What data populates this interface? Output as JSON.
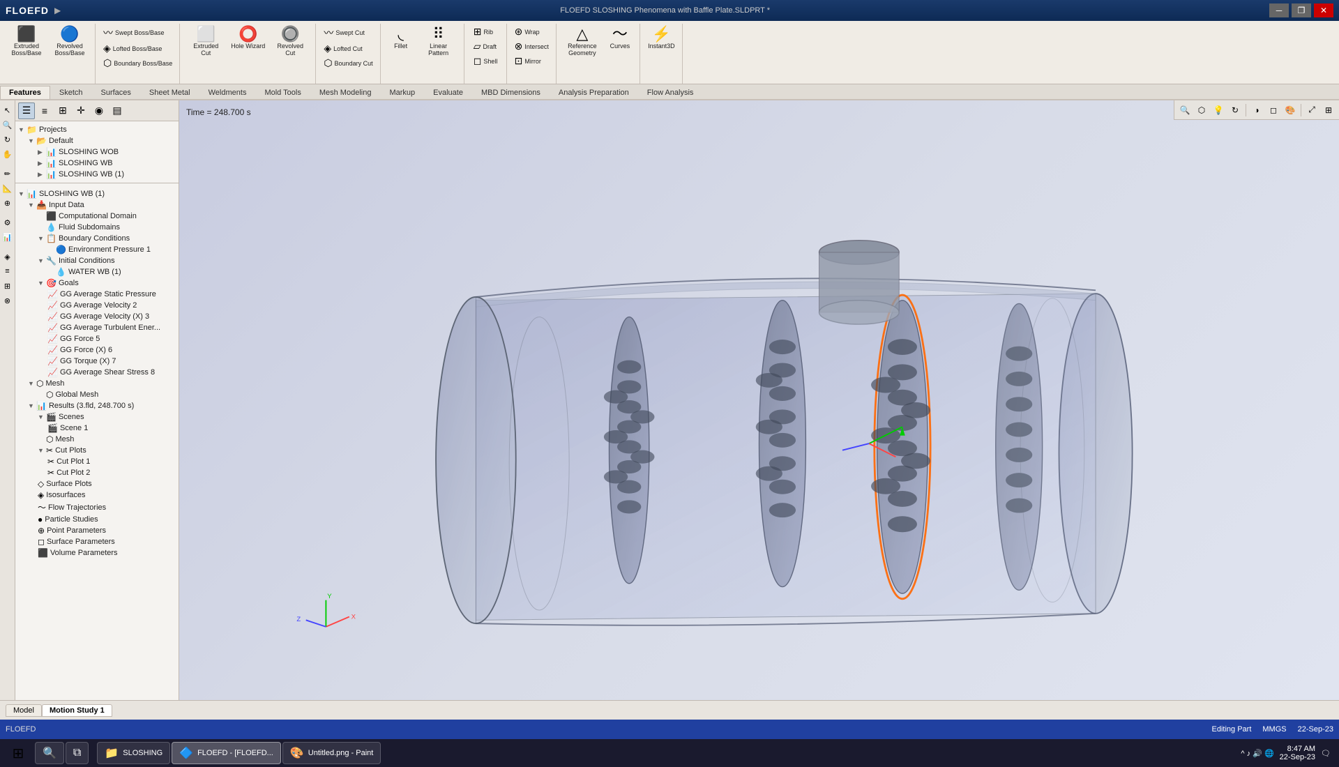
{
  "titlebar": {
    "logo": "FLOEFD",
    "title": "FLOEFD SLOSHING Phenomena with Baffle Plate.SLDPRT *",
    "win_min": "─",
    "win_restore": "❐",
    "win_close": "✕"
  },
  "ribbon": {
    "groups": [
      {
        "name": "extrude-group",
        "buttons": [
          {
            "id": "extruded-boss",
            "icon": "⬛",
            "label": "Extruded Boss/Base"
          },
          {
            "id": "revolved-boss",
            "icon": "🔵",
            "label": "Revolved Boss/Base"
          }
        ]
      },
      {
        "name": "swept-group",
        "buttons": [
          {
            "id": "swept-boss",
            "icon": "〰",
            "label": "Swept Boss/Base"
          },
          {
            "id": "lofted-boss",
            "icon": "◈",
            "label": "Lofted Boss/Base"
          },
          {
            "id": "boundary-boss",
            "icon": "⬡",
            "label": "Boundary Boss/Base"
          }
        ]
      },
      {
        "name": "cut-group",
        "buttons": [
          {
            "id": "extruded-cut",
            "icon": "⬜",
            "label": "Extruded Cut"
          },
          {
            "id": "hole-wizard",
            "icon": "⭕",
            "label": "Hole Wizard"
          },
          {
            "id": "revolved-cut",
            "icon": "🔘",
            "label": "Revolved Cut"
          }
        ]
      },
      {
        "name": "cut-group2",
        "buttons": [
          {
            "id": "swept-cut",
            "icon": "〰",
            "label": "Swept Cut"
          },
          {
            "id": "lofted-cut",
            "icon": "◈",
            "label": "Lofted Cut"
          },
          {
            "id": "boundary-cut",
            "icon": "⬡",
            "label": "Boundary Cut"
          }
        ]
      },
      {
        "name": "features-group",
        "buttons": [
          {
            "id": "fillet",
            "icon": "◟",
            "label": "Fillet"
          },
          {
            "id": "linear-pattern",
            "icon": "⠿",
            "label": "Linear Pattern"
          }
        ]
      },
      {
        "name": "features-group2",
        "buttons": [
          {
            "id": "rib",
            "icon": "⊞",
            "label": "Rib"
          },
          {
            "id": "draft",
            "icon": "▱",
            "label": "Draft"
          },
          {
            "id": "shell",
            "icon": "◻",
            "label": "Shell"
          }
        ]
      },
      {
        "name": "wrap-group",
        "buttons": [
          {
            "id": "wrap",
            "icon": "⊛",
            "label": "Wrap"
          },
          {
            "id": "intersect",
            "icon": "⊗",
            "label": "Intersect"
          },
          {
            "id": "mirror",
            "icon": "⊡",
            "label": "Mirror"
          }
        ]
      },
      {
        "name": "ref-group",
        "buttons": [
          {
            "id": "reference-geometry",
            "icon": "△",
            "label": "Reference Geometry"
          },
          {
            "id": "curves",
            "icon": "〜",
            "label": "Curves"
          }
        ]
      },
      {
        "name": "instant3d-group",
        "buttons": [
          {
            "id": "instant3d",
            "icon": "⚡",
            "label": "Instant3D"
          }
        ]
      }
    ]
  },
  "feature_tabs": [
    "Features",
    "Sketch",
    "Surfaces",
    "Sheet Metal",
    "Weldments",
    "Mold Tools",
    "Mesh Modeling",
    "Markup",
    "Evaluate",
    "MBD Dimensions",
    "Analysis Preparation",
    "Flow Analysis"
  ],
  "active_feature_tab": "Features",
  "panel_toolbar": {
    "buttons": [
      "☰",
      "≡",
      "⊞",
      "✛",
      "◉",
      "▤"
    ]
  },
  "tree": {
    "sections": [
      {
        "id": "projects",
        "label": "Projects",
        "icon": "📁",
        "expanded": true,
        "children": [
          {
            "id": "default",
            "label": "Default",
            "icon": "📂",
            "expanded": true,
            "children": [
              {
                "id": "sloshing-wob",
                "label": "SLOSHING WOB",
                "icon": "📊",
                "indent": 2
              },
              {
                "id": "sloshing-wb",
                "label": "SLOSHING WB",
                "icon": "📊",
                "indent": 2
              },
              {
                "id": "sloshing-wb1",
                "label": "SLOSHING WB (1)",
                "icon": "📊",
                "indent": 2
              }
            ]
          }
        ]
      },
      {
        "id": "sloshing-wb-main",
        "label": "SLOSHING WB (1)",
        "icon": "📊",
        "expanded": true,
        "separator": true,
        "children": [
          {
            "id": "input-data",
            "label": "Input Data",
            "icon": "📥",
            "indent": 1,
            "expanded": true,
            "children": [
              {
                "id": "comp-domain",
                "label": "Computational Domain",
                "icon": "⬛",
                "indent": 2
              },
              {
                "id": "fluid-sub",
                "label": "Fluid Subdomains",
                "icon": "💧",
                "indent": 2
              },
              {
                "id": "boundary-cond",
                "label": "Boundary Conditions",
                "icon": "📋",
                "indent": 2,
                "expanded": true,
                "children": [
                  {
                    "id": "env-pressure",
                    "label": "Environment Pressure 1",
                    "icon": "🔵",
                    "indent": 3
                  }
                ]
              },
              {
                "id": "initial-cond",
                "label": "Initial Conditions",
                "icon": "🔧",
                "indent": 2,
                "expanded": true,
                "children": [
                  {
                    "id": "water-wb",
                    "label": "WATER WB (1)",
                    "icon": "💧",
                    "indent": 3
                  }
                ]
              },
              {
                "id": "goals",
                "label": "Goals",
                "icon": "🎯",
                "indent": 2,
                "expanded": true,
                "children": [
                  {
                    "id": "gg-avg-static",
                    "label": "GG Average Static Pressure",
                    "icon": "📈",
                    "indent": 3
                  },
                  {
                    "id": "gg-avg-vel2",
                    "label": "GG Average Velocity 2",
                    "icon": "📈",
                    "indent": 3
                  },
                  {
                    "id": "gg-avg-vel3",
                    "label": "GG Average Velocity (X) 3",
                    "icon": "📈",
                    "indent": 3
                  },
                  {
                    "id": "gg-avg-turb",
                    "label": "GG Average Turbulent Energ...",
                    "icon": "📈",
                    "indent": 3
                  },
                  {
                    "id": "gg-force5",
                    "label": "GG Force 5",
                    "icon": "📈",
                    "indent": 3
                  },
                  {
                    "id": "gg-force6",
                    "label": "GG Force (X) 6",
                    "icon": "📈",
                    "indent": 3
                  },
                  {
                    "id": "gg-torque7",
                    "label": "GG Torque (X) 7",
                    "icon": "📈",
                    "indent": 3
                  },
                  {
                    "id": "gg-shear8",
                    "label": "GG Average Shear Stress 8",
                    "icon": "📈",
                    "indent": 3
                  }
                ]
              }
            ]
          },
          {
            "id": "mesh",
            "label": "Mesh",
            "icon": "⬡",
            "indent": 1,
            "expanded": true,
            "children": [
              {
                "id": "global-mesh",
                "label": "Global Mesh",
                "icon": "⬡",
                "indent": 2
              }
            ]
          },
          {
            "id": "results",
            "label": "Results (3.fld, 248.700 s)",
            "icon": "📊",
            "indent": 1,
            "expanded": true,
            "children": [
              {
                "id": "scenes",
                "label": "Scenes",
                "icon": "🎬",
                "indent": 2,
                "expanded": true,
                "children": [
                  {
                    "id": "scene1",
                    "label": "Scene 1",
                    "icon": "🎬",
                    "indent": 3
                  }
                ]
              },
              {
                "id": "mesh-result",
                "label": "Mesh",
                "icon": "⬡",
                "indent": 2
              },
              {
                "id": "cut-plots",
                "label": "Cut Plots",
                "icon": "✂",
                "indent": 2,
                "expanded": true,
                "children": [
                  {
                    "id": "cut-plot1",
                    "label": "Cut Plot 1",
                    "icon": "✂",
                    "indent": 3
                  },
                  {
                    "id": "cut-plot2",
                    "label": "Cut Plot 2",
                    "icon": "✂",
                    "indent": 3
                  }
                ]
              },
              {
                "id": "surface-plots",
                "label": "Surface Plots",
                "icon": "◇",
                "indent": 2
              },
              {
                "id": "isosurfaces",
                "label": "Isosurfaces",
                "icon": "◈",
                "indent": 2
              },
              {
                "id": "flow-traj",
                "label": "Flow Trajectories",
                "icon": "〜",
                "indent": 2
              },
              {
                "id": "particle-studies",
                "label": "Particle Studies",
                "icon": "●",
                "indent": 2
              },
              {
                "id": "point-params",
                "label": "Point Parameters",
                "icon": "⊕",
                "indent": 2
              },
              {
                "id": "surface-params",
                "label": "Surface Parameters",
                "icon": "◻",
                "indent": 2
              },
              {
                "id": "volume-params",
                "label": "Volume Parameters",
                "icon": "⬛",
                "indent": 2
              }
            ]
          }
        ]
      }
    ]
  },
  "viewport": {
    "time_label": "Time = 248.700 s",
    "bg_gradient": "linear-gradient(135deg, #b8bcd0 0%, #c8cce0 40%, #d8dce8 100%)"
  },
  "bottom_tabs": [
    "Model",
    "Motion Study 1"
  ],
  "active_bottom_tab": "Model",
  "statusbar": {
    "left": "FLOEFD",
    "center": "Editing Part",
    "right_units": "MMGS",
    "right_date": "22-Sep-23"
  },
  "taskbar": {
    "start_icon": "⊞",
    "search_icon": "🔍",
    "apps": [
      {
        "id": "windows",
        "icon": "⊞",
        "label": ""
      },
      {
        "id": "search",
        "icon": "🔍",
        "label": ""
      },
      {
        "id": "taskview",
        "icon": "⧉",
        "label": ""
      }
    ],
    "open_apps": [
      {
        "id": "sloshing-app",
        "icon": "📁",
        "label": "SLOSHING"
      },
      {
        "id": "floefd-app",
        "icon": "🔷",
        "label": "FLOEFD - [FLOEFD..."
      },
      {
        "id": "paint-app",
        "icon": "🎨",
        "label": "Untitled.png - Paint"
      }
    ],
    "system": {
      "time": "8:47 AM",
      "date": "22-Sep-23"
    }
  },
  "viewport_toolbar_buttons": [
    "🔍",
    "🔲",
    "✏",
    "💡",
    "⬡",
    "🎨",
    "◐",
    "📷",
    "▶",
    "⚙"
  ],
  "left_icons": [
    "↖",
    "◻",
    "✏",
    "📐",
    "⊕",
    "🔧",
    "⚡",
    "◈",
    "≡",
    "⊞",
    "📊",
    "⊗"
  ]
}
